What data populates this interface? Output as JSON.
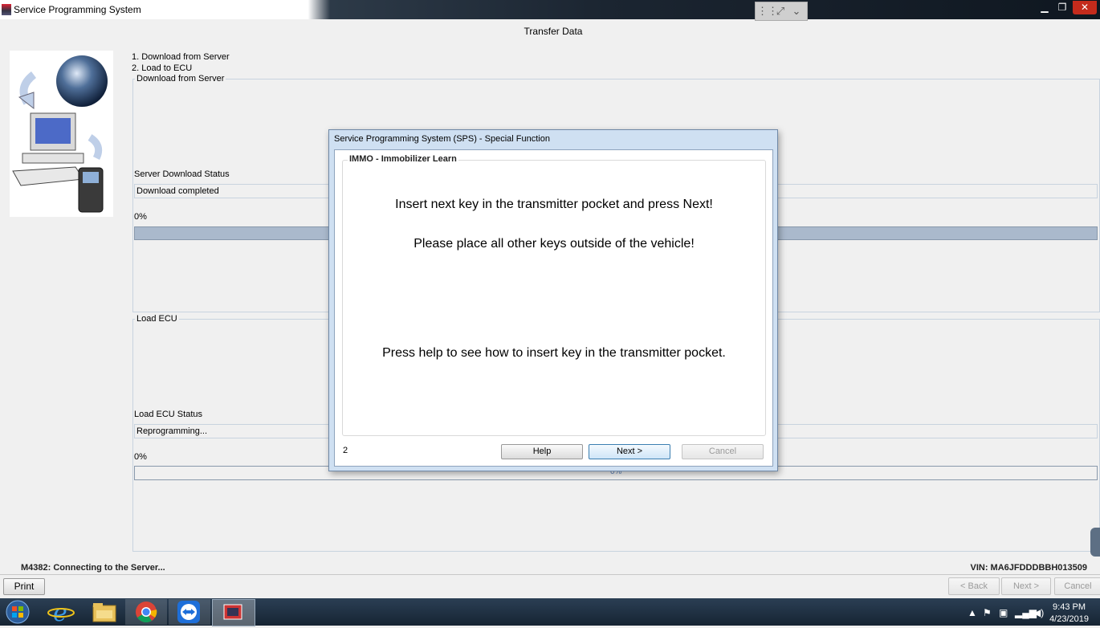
{
  "window": {
    "title": "Service Programming System"
  },
  "page": {
    "title": "Transfer Data"
  },
  "steps": [
    "1. Download from Server",
    "2. Load to ECU"
  ],
  "download": {
    "group_label": "Download from Server",
    "status_label": "Server Download Status",
    "status_value": "Download completed",
    "percent_label": "0%",
    "progress": 1.0
  },
  "load": {
    "group_label": "Load ECU",
    "status_label": "Load ECU Status",
    "status_value": "Reprogramming...",
    "percent_label": "0%",
    "bar_text": "0%",
    "progress": 0
  },
  "status_bar": {
    "message": "M4382: Connecting to the Server...",
    "vin": "VIN: MA6JFDDDBBH013509"
  },
  "buttons": {
    "print": "Print",
    "back": "< Back",
    "next": "Next >",
    "cancel": "Cancel"
  },
  "dialog": {
    "title": "Service Programming System (SPS) - Special Function",
    "group_label": "IMMO - Immobilizer Learn",
    "line1": "Insert next key in the transmitter pocket and press Next!",
    "line2": "Please place all other keys outside of the vehicle!",
    "line3": "Press help to see how to insert key in the transmitter pocket.",
    "step_number": "2",
    "help": "Help",
    "next": "Next >",
    "cancel": "Cancel"
  },
  "taskbar": {
    "time": "9:43 PM",
    "date": "4/23/2019",
    "apps": [
      "windows-start-icon",
      "internet-explorer-icon",
      "file-explorer-icon",
      "chrome-icon",
      "teamviewer-icon",
      "sps-app-icon"
    ]
  },
  "colors": {
    "progress_fill": "#aab9cc",
    "dialog_frame": "#cfe0f2",
    "taskbar": "#1d2c3c"
  }
}
